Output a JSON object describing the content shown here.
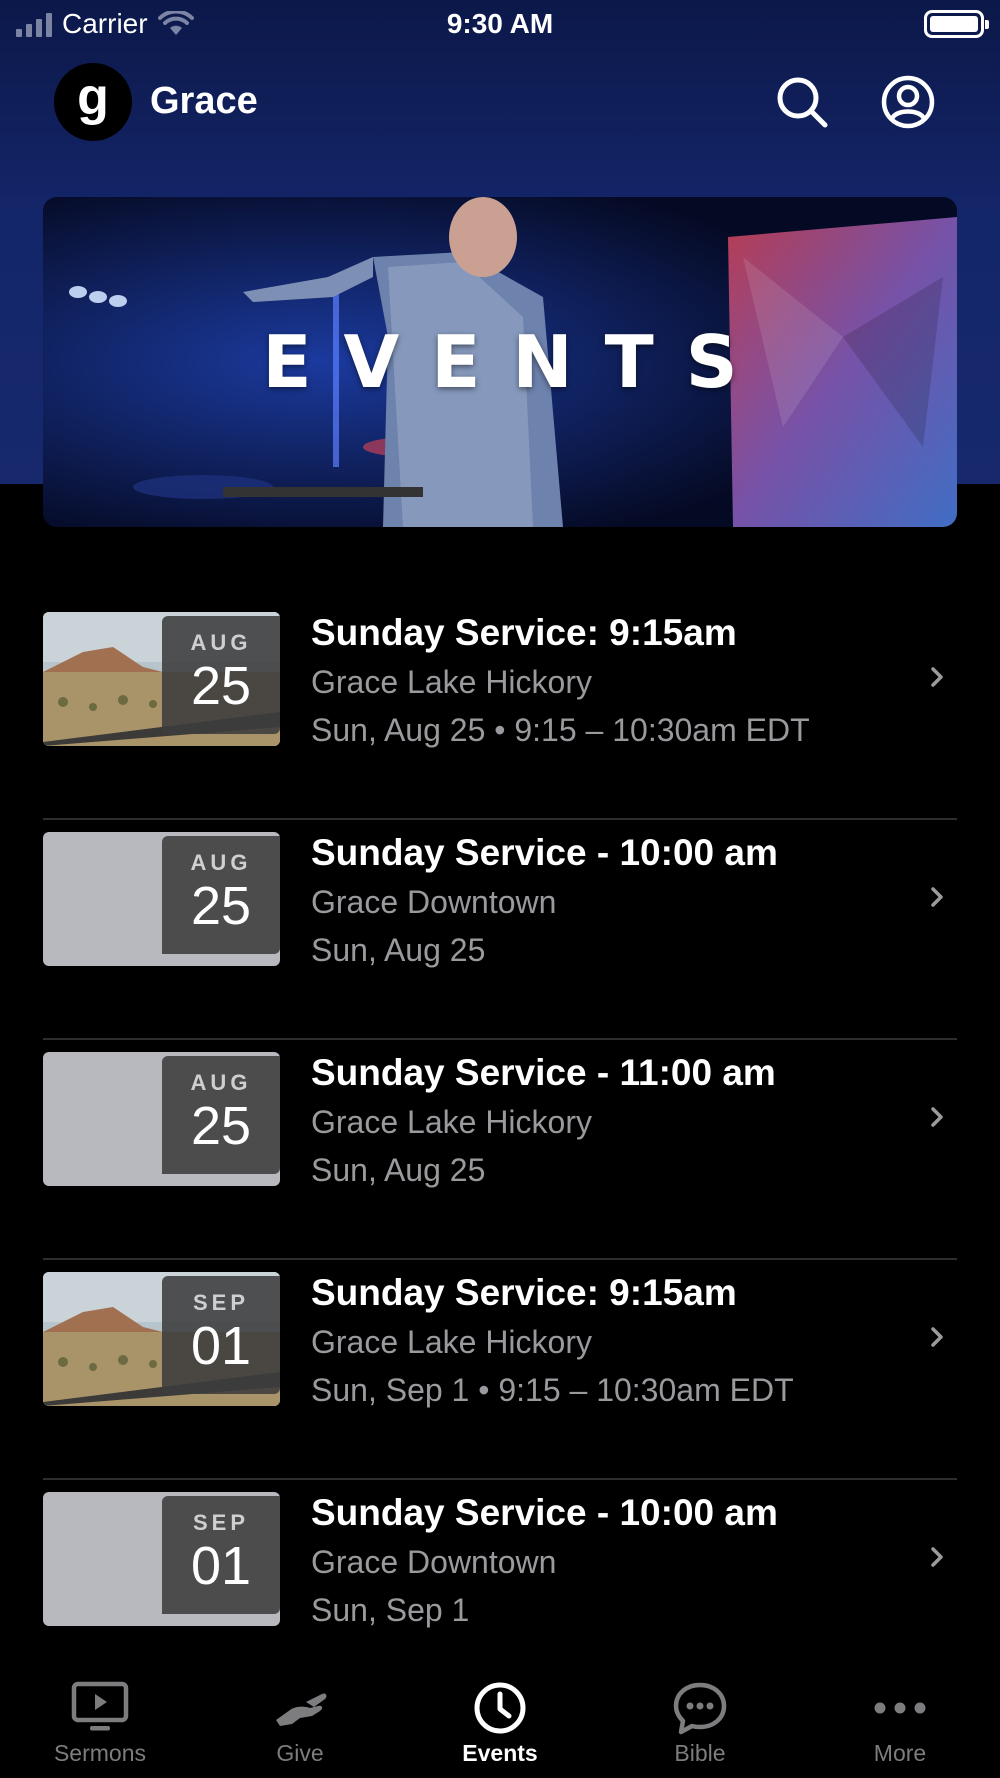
{
  "status_bar": {
    "carrier": "Carrier",
    "time": "9:30 AM"
  },
  "header": {
    "logo_letter": "g",
    "app_name": "Grace",
    "icons": [
      "search-icon",
      "profile-icon"
    ]
  },
  "hero": {
    "title": "EVENTS"
  },
  "events": [
    {
      "month": "AUG",
      "day": "25",
      "title": "Sunday Service: 9:15am",
      "location": "Grace Lake Hickory",
      "time": "Sun, Aug 25 • 9:15 – 10:30am EDT",
      "thumbnail": "desert-road"
    },
    {
      "month": "AUG",
      "day": "25",
      "title": "Sunday Service - 10:00 am",
      "location": "Grace Downtown",
      "time": "Sun, Aug 25",
      "thumbnail": "placeholder"
    },
    {
      "month": "AUG",
      "day": "25",
      "title": "Sunday Service - 11:00 am",
      "location": "Grace Lake Hickory",
      "time": "Sun, Aug 25",
      "thumbnail": "placeholder"
    },
    {
      "month": "SEP",
      "day": "01",
      "title": "Sunday Service: 9:15am",
      "location": "Grace Lake Hickory",
      "time": "Sun, Sep 1 • 9:15 – 10:30am EDT",
      "thumbnail": "desert-road"
    },
    {
      "month": "SEP",
      "day": "01",
      "title": "Sunday Service - 10:00 am",
      "location": "Grace Downtown",
      "time": "Sun, Sep 1",
      "thumbnail": "placeholder"
    }
  ],
  "tabs": [
    {
      "label": "Sermons",
      "icon": "tv-play-icon",
      "active": false
    },
    {
      "label": "Give",
      "icon": "hand-give-icon",
      "active": false
    },
    {
      "label": "Events",
      "icon": "clock-icon",
      "active": true
    },
    {
      "label": "Bible",
      "icon": "chat-bubble-icon",
      "active": false
    },
    {
      "label": "More",
      "icon": "more-dots-icon",
      "active": false
    }
  ],
  "colors": {
    "header_bg": "#14266a",
    "background": "#000000",
    "secondary_text": "#9a9a9e",
    "tab_inactive": "#7d7d80"
  }
}
